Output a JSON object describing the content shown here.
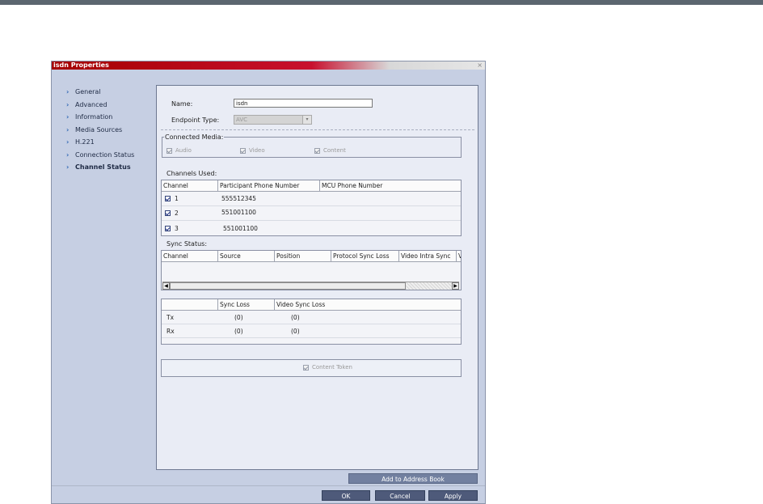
{
  "window": {
    "title": "isdn Properties",
    "close_glyph": "×"
  },
  "nav": {
    "items": [
      {
        "label": "General"
      },
      {
        "label": "Advanced"
      },
      {
        "label": "Information"
      },
      {
        "label": "Media Sources"
      },
      {
        "label": "H.221"
      },
      {
        "label": "Connection Status"
      },
      {
        "label": "Channel Status"
      }
    ],
    "active": "Channel Status"
  },
  "form": {
    "name_label": "Name:",
    "name_value": "isdn",
    "endpoint_type_label": "Endpoint Type:",
    "endpoint_type_value": "AVC"
  },
  "connected_media": {
    "legend": "Connected Media:",
    "audio": "Audio",
    "video": "Video",
    "content": "Content"
  },
  "channels": {
    "label": "Channels Used:",
    "headers": [
      "Channel",
      "Participant Phone Number",
      "MCU Phone Number"
    ],
    "rows": [
      {
        "channel": "1",
        "participant": "555512345",
        "mcu": "",
        "checked": true
      },
      {
        "channel": "2",
        "participant": "551001100",
        "mcu": "",
        "checked": true
      },
      {
        "channel": "3",
        "participant": "551001100",
        "mcu": "",
        "checked": true
      }
    ]
  },
  "sync": {
    "label": "Sync Status:",
    "headers": [
      "Channel",
      "Source",
      "Position",
      "Protocol Sync Loss",
      "Video Intra Sync",
      "V"
    ]
  },
  "loss": {
    "headers": [
      "",
      "Sync Loss",
      "Video Sync Loss"
    ],
    "rows": [
      {
        "label": "Tx",
        "sync_loss": "(0)",
        "video_sync_loss": "(0)"
      },
      {
        "label": "Rx",
        "sync_loss": "(0)",
        "video_sync_loss": "(0)"
      }
    ]
  },
  "content_token": {
    "label": "Content Token"
  },
  "buttons": {
    "add_to_address_book": "Add to Address Book",
    "ok": "OK",
    "cancel": "Cancel",
    "apply": "Apply"
  },
  "scrollbar": {
    "left_arrow": "◀",
    "right_arrow": "▶"
  },
  "icons": {
    "nav_chevron": "chevron-right-icon",
    "select_arrow": "chevron-down-icon",
    "nav_chevron_glyph": "›",
    "select_arrow_glyph": "▾"
  },
  "colors": {
    "title_bar": "#c8102e",
    "sidebar": "#c6cfe3",
    "panel": "#e9ecf5",
    "button": "#4e5a7a",
    "nav_chevron": "#2b64b3"
  }
}
